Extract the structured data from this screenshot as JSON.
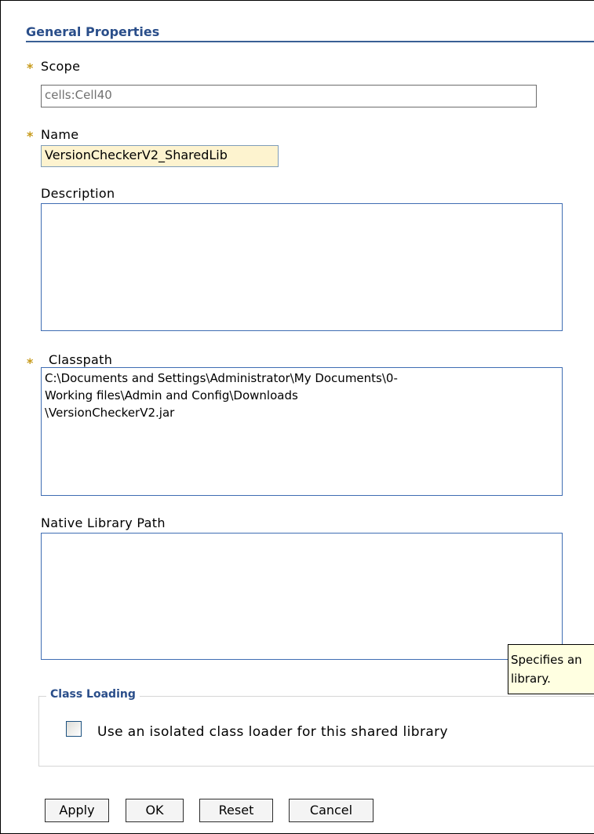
{
  "section": {
    "title": "General Properties"
  },
  "fields": {
    "scope": {
      "label": "Scope",
      "value": "cells:Cell40"
    },
    "name": {
      "label": "Name",
      "value": "VersionCheckerV2_SharedLib"
    },
    "description": {
      "label": "Description",
      "value": ""
    },
    "classpath": {
      "label": "Classpath",
      "value": "C:\\Documents and Settings\\Administrator\\My Documents\\0-\nWorking files\\Admin and Config\\Downloads\n\\VersionCheckerV2.jar"
    },
    "native_library_path": {
      "label": "Native Library Path",
      "value": ""
    }
  },
  "required_marker": "*",
  "tooltip": {
    "text_line1": "Specifies an",
    "text_line2": "library."
  },
  "class_loading": {
    "legend": "Class Loading",
    "checkbox_label": "Use an isolated class loader for this shared library",
    "checked": false
  },
  "buttons": {
    "apply": "Apply",
    "ok": "OK",
    "reset": "Reset",
    "cancel": "Cancel"
  },
  "colors": {
    "header_text": "#2a4e8a",
    "required_star": "#c79a1a",
    "focused_field_bg": "#fdf3cf",
    "tooltip_bg": "#ffffe1"
  }
}
